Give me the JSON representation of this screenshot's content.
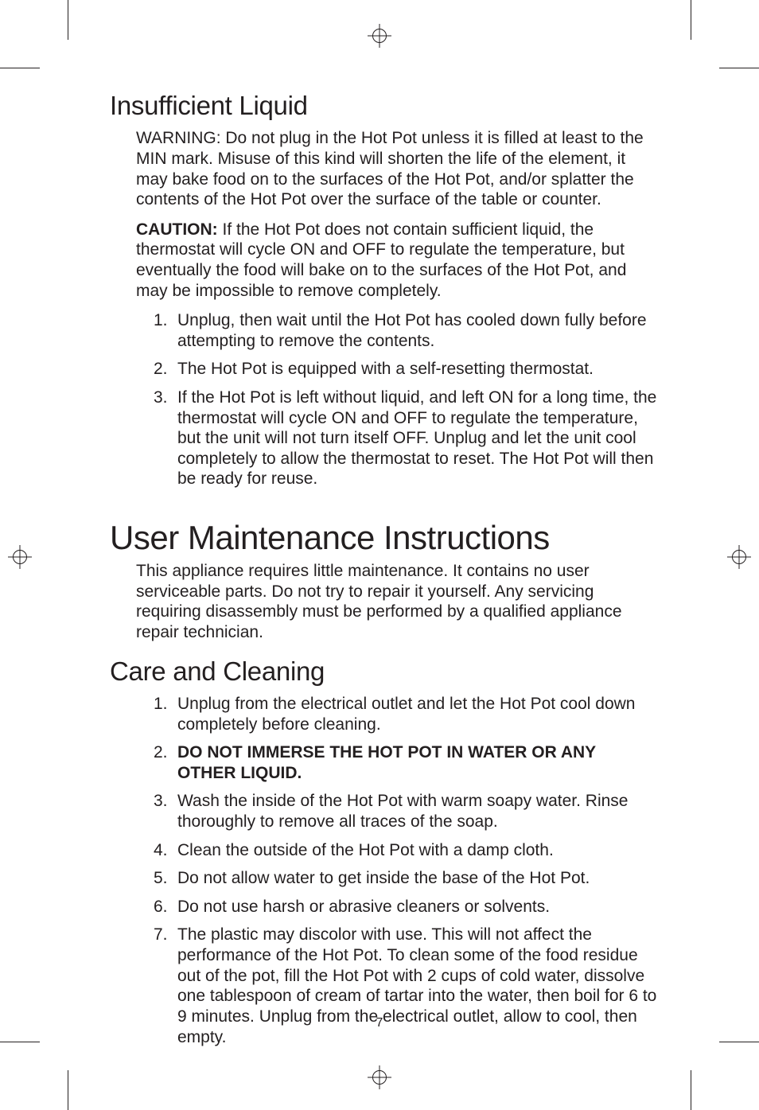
{
  "section1": {
    "heading": "Insufficient Liquid",
    "p1": "WARNING: Do not plug in the Hot Pot unless it is filled at least to the MIN mark. Misuse of this kind will shorten the life of the element, it may bake food on to the surfaces of the Hot Pot, and/or splatter the contents of the Hot Pot over the surface of the table or counter.",
    "p2_lead": "CAUTION:",
    "p2_rest": " If the Hot Pot does not contain sufficient liquid, the thermostat will cycle ON and OFF to regulate the temperature, but eventually the food will bake on to the surfaces of the Hot Pot, and may be impossible to remove completely.",
    "items": [
      "Unplug, then wait until the Hot Pot has cooled down fully before attempting to remove the contents.",
      "The Hot Pot is equipped with a self-resetting thermostat.",
      "If the Hot Pot is left without liquid, and left ON for a long time, the thermostat will cycle ON and OFF to regulate the temperature, but the unit will not turn itself OFF. Unplug and let the unit cool completely to allow the thermostat to reset. The Hot Pot will then be ready for reuse."
    ]
  },
  "section2": {
    "heading": "User Maintenance Instructions",
    "p1": "This appliance requires little maintenance. It contains no user serviceable parts. Do not try to repair it yourself. Any servicing requiring disassembly must be performed by a qualified appliance repair technician."
  },
  "section3": {
    "heading": "Care and Cleaning",
    "items": [
      {
        "text": "Unplug from the electrical outlet and let the Hot Pot cool down completely before cleaning."
      },
      {
        "bold": "DO NOT IMMERSE THE HOT POT IN WATER OR ANY OTHER LIQUID."
      },
      {
        "text": "Wash the inside of the Hot Pot with warm soapy water. Rinse thoroughly to remove all traces of the soap."
      },
      {
        "text": "Clean the outside of the Hot Pot with a damp cloth."
      },
      {
        "text": "Do not allow water to get inside the base of the Hot Pot."
      },
      {
        "text": "Do not use harsh or abrasive cleaners or solvents."
      },
      {
        "text": "The plastic may discolor with use. This will not affect the performance of the Hot Pot. To clean some of the food residue out of the pot, fill the Hot Pot with 2 cups of cold water, dissolve one tablespoon of cream of tartar into the water, then boil for 6 to 9 minutes. Unplug from the electrical outlet, allow to cool, then empty."
      }
    ]
  },
  "page_number": "7"
}
